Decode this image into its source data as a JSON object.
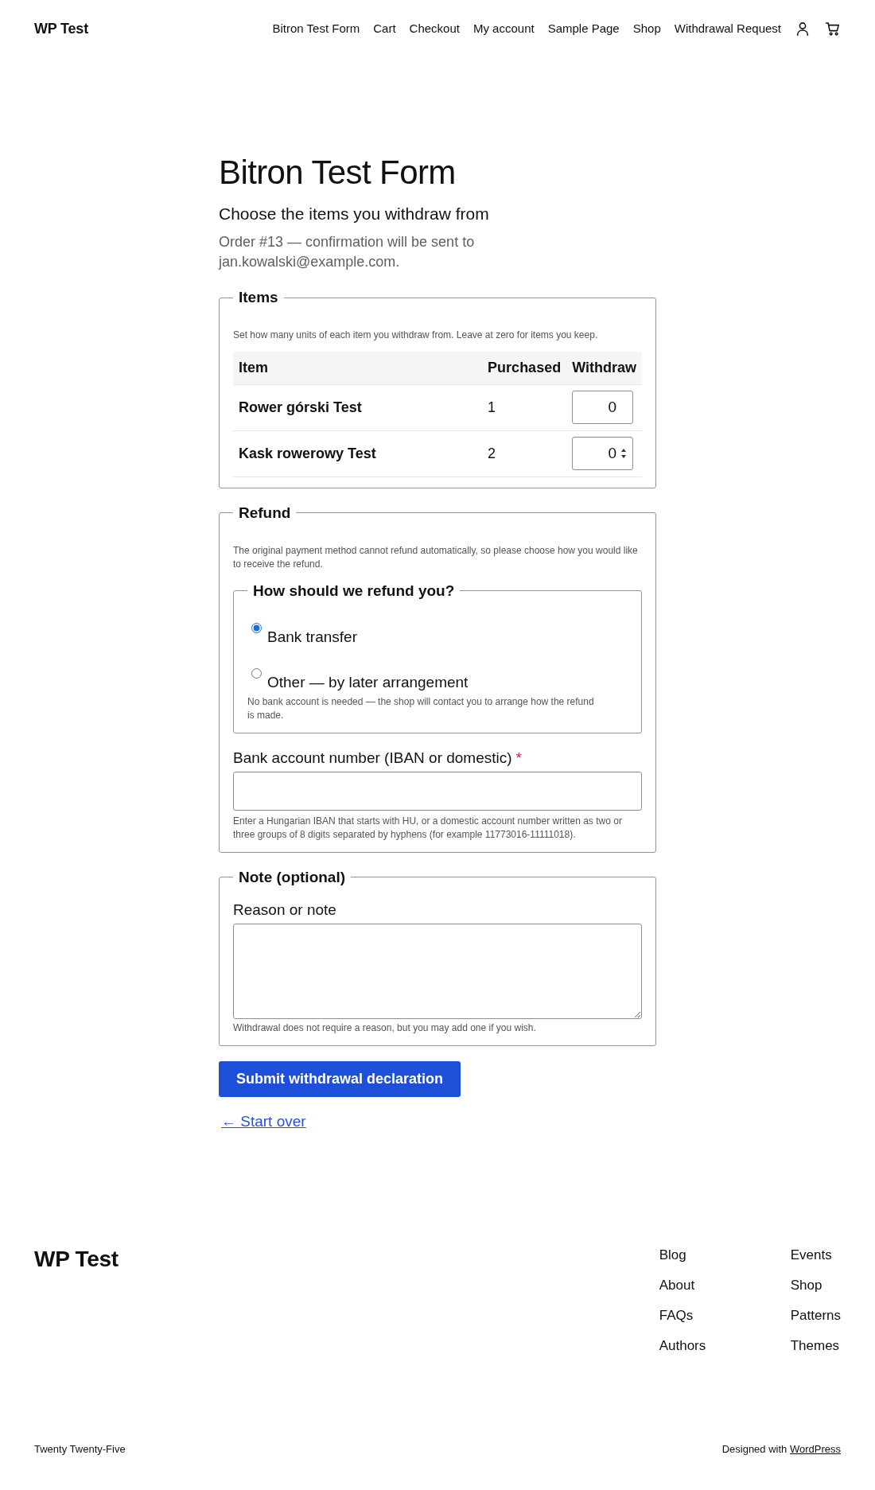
{
  "header": {
    "site_title": "WP Test",
    "nav": [
      "Bitron Test Form",
      "Cart",
      "Checkout",
      "My account",
      "Sample Page",
      "Shop",
      "Withdrawal Request"
    ]
  },
  "page": {
    "title": "Bitron Test Form",
    "subtitle": "Choose the items you withdraw from",
    "order_note": "Order #13 — confirmation will be sent to jan.kowalski@example.com."
  },
  "items_section": {
    "legend": "Items",
    "help": "Set how many units of each item you withdraw from. Leave at zero for items you keep.",
    "table": {
      "columns": [
        "Item",
        "Purchased",
        "Withdraw"
      ],
      "rows": [
        {
          "item": "Rower górski Test",
          "purchased": "1",
          "withdraw": "0",
          "hovered": false
        },
        {
          "item": "Kask rowerowy Test",
          "purchased": "2",
          "withdraw": "0",
          "hovered": true
        }
      ]
    }
  },
  "refund_section": {
    "legend": "Refund",
    "help": "The original payment method cannot refund automatically, so please choose how you would like to receive the refund.",
    "method_group": {
      "legend": "How should we refund you?",
      "options": [
        {
          "label": "Bank transfer",
          "selected": true
        },
        {
          "label": "Other — by later arrangement",
          "selected": false,
          "description": "No bank account is needed — the shop will contact you to arrange how the refund is made."
        }
      ]
    },
    "account_field": {
      "label": "Bank account number (IBAN or domestic)",
      "required_mark": "*",
      "help": "Enter a Hungarian IBAN that starts with HU, or a domestic account number written as two or three groups of 8 digits separated by hyphens (for example 11773016-11111018)."
    }
  },
  "note_section": {
    "legend": "Note (optional)",
    "field": {
      "label": "Reason or note",
      "help": "Withdrawal does not require a reason, but you may add one if you wish."
    }
  },
  "submit_button": "Submit withdrawal declaration",
  "start_over_link": "← Start over",
  "footer": {
    "site_title": "WP Test",
    "link_columns": [
      [
        "Blog",
        "About",
        "FAQs",
        "Authors"
      ],
      [
        "Events",
        "Shop",
        "Patterns",
        "Themes"
      ]
    ],
    "theme_credit": "Twenty Twenty-Five",
    "designed_with": {
      "text": "Designed with",
      "link": "WordPress"
    }
  }
}
